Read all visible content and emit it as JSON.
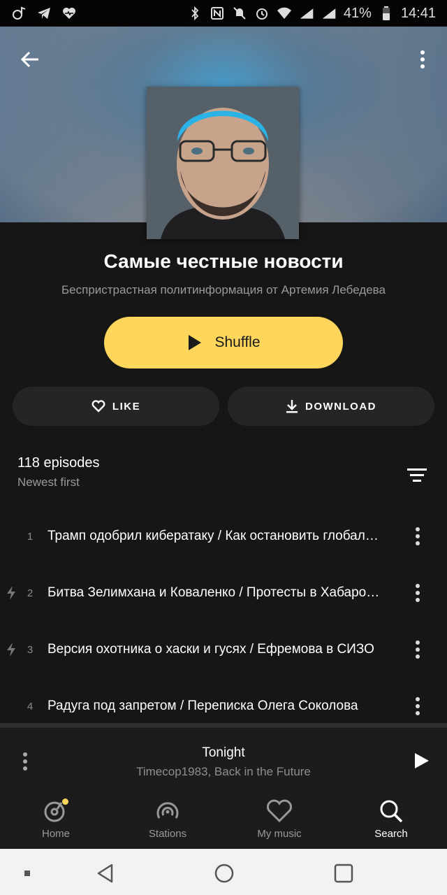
{
  "status_bar": {
    "battery": "41%",
    "time": "14:41",
    "icons": [
      "music-icon",
      "telegram-icon",
      "health-icon",
      "bluetooth-icon",
      "nfc-icon",
      "mute-icon",
      "alarm-icon",
      "wifi-icon",
      "signal-icon",
      "signal-icon",
      "battery-icon"
    ]
  },
  "header": {
    "back_icon": "arrow-left-icon",
    "menu_icon": "more-vertical-icon"
  },
  "podcast": {
    "title": "Самые честные новости",
    "subtitle": "Беспристрастная политинформация от Артемия Лебедева"
  },
  "buttons": {
    "shuffle": "Shuffle",
    "like": "LIKE",
    "download": "DOWNLOAD"
  },
  "episodes": {
    "count_label": "118 episodes",
    "sort_label": "Newest first",
    "items": [
      {
        "num": "1",
        "title": "Трамп одобрил кибератаку / Как остановить глобальное потепление",
        "bolt": false
      },
      {
        "num": "2",
        "title": "Битва Зелимхана и Коваленко / Протесты в Хабаровске",
        "bolt": true
      },
      {
        "num": "3",
        "title": "Версия охотника о хаски и гусях / Ефремова в СИЗО",
        "bolt": true
      },
      {
        "num": "4",
        "title": "Радуга под запретом / Переписка Олега Соколова",
        "bolt": false
      }
    ]
  },
  "mini_player": {
    "title": "Tonight",
    "artist": "Timecop1983, Back in the Future"
  },
  "bottom_nav": [
    {
      "label": "Home",
      "icon": "home-disc-icon"
    },
    {
      "label": "Stations",
      "icon": "stations-icon"
    },
    {
      "label": "My music",
      "icon": "heart-icon"
    },
    {
      "label": "Search",
      "icon": "search-icon",
      "active": true
    }
  ],
  "colors": {
    "accent": "#fed65c",
    "background": "#161616",
    "button_bg": "#252525"
  }
}
